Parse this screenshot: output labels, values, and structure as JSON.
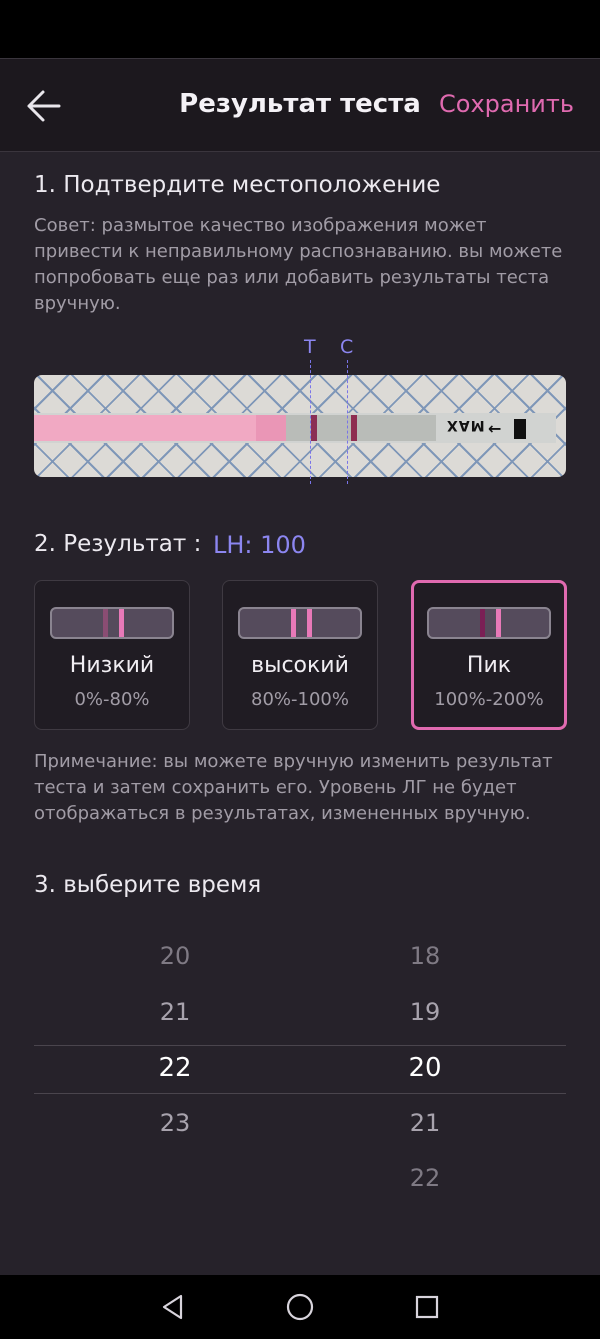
{
  "header": {
    "title": "Результат теста",
    "save_label": "Сохранить",
    "accent_color": "#e06ab0"
  },
  "section1": {
    "title": "1. Подтвердите местоположение",
    "tip": "Совет: размытое качество изображения может привести к неправильному распознаванию. вы можете попробовать еще раз или добавить результаты теста вручную.",
    "marker_t": "T",
    "marker_c": "C",
    "strip_text": "MAX"
  },
  "section2": {
    "label": "2. Результат :",
    "value": "LH: 100",
    "options": [
      {
        "name": "Низкий",
        "range": "0%-80%",
        "selected": false
      },
      {
        "name": "высокий",
        "range": "80%-100%",
        "selected": false
      },
      {
        "name": "Пик",
        "range": "100%-200%",
        "selected": true
      }
    ],
    "note": "Примечание: вы можете вручную изменить результат теста и затем сохранить его. Уровень ЛГ не будет отображаться в результатах, измененных вручную."
  },
  "section3": {
    "title": "3. выберите время",
    "hours": [
      "20",
      "21",
      "22",
      "23"
    ],
    "hour_selected": "22",
    "minutes": [
      "18",
      "19",
      "20",
      "21",
      "22"
    ],
    "minute_selected": "20"
  },
  "icons": {
    "back": "arrow-left-icon",
    "nav_back": "triangle-back-icon",
    "nav_home": "circle-home-icon",
    "nav_recent": "square-recent-icon"
  }
}
